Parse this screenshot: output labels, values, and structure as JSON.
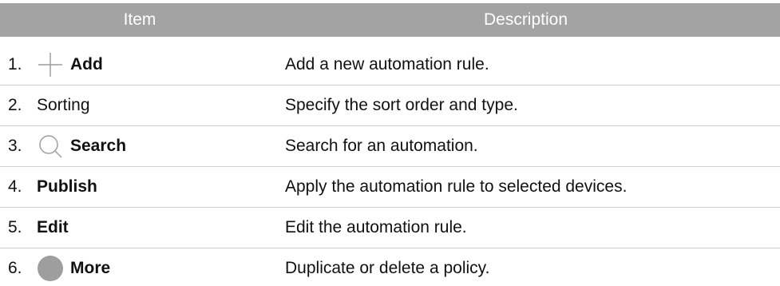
{
  "table": {
    "header": {
      "item": "Item",
      "description": "Description"
    },
    "rows": [
      {
        "number": "1.",
        "icon": "plus-icon",
        "label": "Add",
        "bold": true,
        "description": "Add a new automation rule."
      },
      {
        "number": "2.",
        "icon": "",
        "label": "Sorting",
        "bold": false,
        "description": "Specify the sort order and type."
      },
      {
        "number": "3.",
        "icon": "search-icon",
        "label": "Search",
        "bold": true,
        "description": "Search for an automation."
      },
      {
        "number": "4.",
        "icon": "",
        "label": "Publish",
        "bold": true,
        "description": "Apply the automation rule to selected devices."
      },
      {
        "number": "5.",
        "icon": "",
        "label": "Edit",
        "bold": true,
        "description": "Edit the automation rule."
      },
      {
        "number": "6.",
        "icon": "more-icon",
        "label": "More",
        "bold": true,
        "description": "Duplicate or delete a policy."
      }
    ]
  },
  "colors": {
    "header_bg": "#a3a3a3",
    "header_text": "#ffffff",
    "separator": "#cfcfcf",
    "icon_gray": "#9e9e9e"
  }
}
